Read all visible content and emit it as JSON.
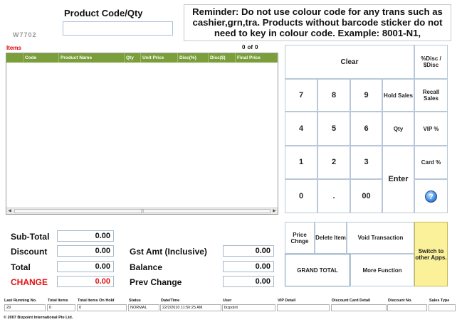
{
  "product": {
    "label": "Product Code/Qty",
    "value": ""
  },
  "faded_text": "W7702",
  "reminder": "Reminder: Do not use colour code for any trans such as cashier,grn,tra. Products without barcode sticker do not need to key in colour code. Example: 8001-N1,",
  "items": {
    "title": "Items",
    "count": "0",
    "of_label": "of",
    "total": "0",
    "columns": [
      "Code",
      "Product Name",
      "Qty",
      "Unit Price",
      "Disc(%)",
      "Disc($)",
      "Final Price"
    ],
    "rows": []
  },
  "keypad": {
    "clear": "Clear",
    "pct_disc": "%Disc / $Disc",
    "seven": "7",
    "eight": "8",
    "nine": "9",
    "hold_sales": "Hold Sales",
    "recall_sales": "Recall Sales",
    "four": "4",
    "five": "5",
    "six": "6",
    "qty": "Qty",
    "vip_pct": "VIP %",
    "one": "1",
    "two": "2",
    "three": "3",
    "enter": "Enter",
    "card_pct": "Card %",
    "zero": "0",
    "dot": ".",
    "double_zero": "00",
    "help_glyph": "?"
  },
  "actions": {
    "price_change": "Price Chnge",
    "delete_item": "Delete Item",
    "void_transaction": "Void Transaction",
    "switch_apps": "Switch to other Apps.",
    "grand_total": "GRAND TOTAL",
    "more_function": "More Function"
  },
  "totals": {
    "subtotal_label": "Sub-Total",
    "subtotal": "0.00",
    "discount_label": "Discount",
    "discount": "0.00",
    "total_label": "Total",
    "total": "0.00",
    "change_label": "CHANGE",
    "change": "0.00",
    "gst_label": "Gst Amt (Inclusive)",
    "gst": "0.00",
    "balance_label": "Balance",
    "balance": "0.00",
    "prev_change_label": "Prev Change",
    "prev_change": "0.00"
  },
  "status_bar": {
    "headers": {
      "last_running": "Last Running No.",
      "total_items": "Total Items",
      "items_on_hold": "Total Items On Hold",
      "status": "Status",
      "datetime": "Date/Time",
      "user": "User",
      "vip_detail": "VIP Detail",
      "discount_card": "Discount Card Detail",
      "discount_no": "Discount No.",
      "sales_type": "Sales Type"
    },
    "values": {
      "last_running": "29",
      "total_items": "0",
      "items_on_hold": "0",
      "status": "NORMAL",
      "datetime": "22/2/2010 11:50:25 AM",
      "user": "bizpoint",
      "vip_detail": "",
      "discount_card": "",
      "discount_no": "",
      "sales_type": ""
    }
  },
  "copyright": "© 2007 Bizpoint International Pte Ltd.",
  "colors": {
    "grid_header": "#7a9e3a",
    "accent_red": "#e01010",
    "switch_button": "#faf19a"
  }
}
